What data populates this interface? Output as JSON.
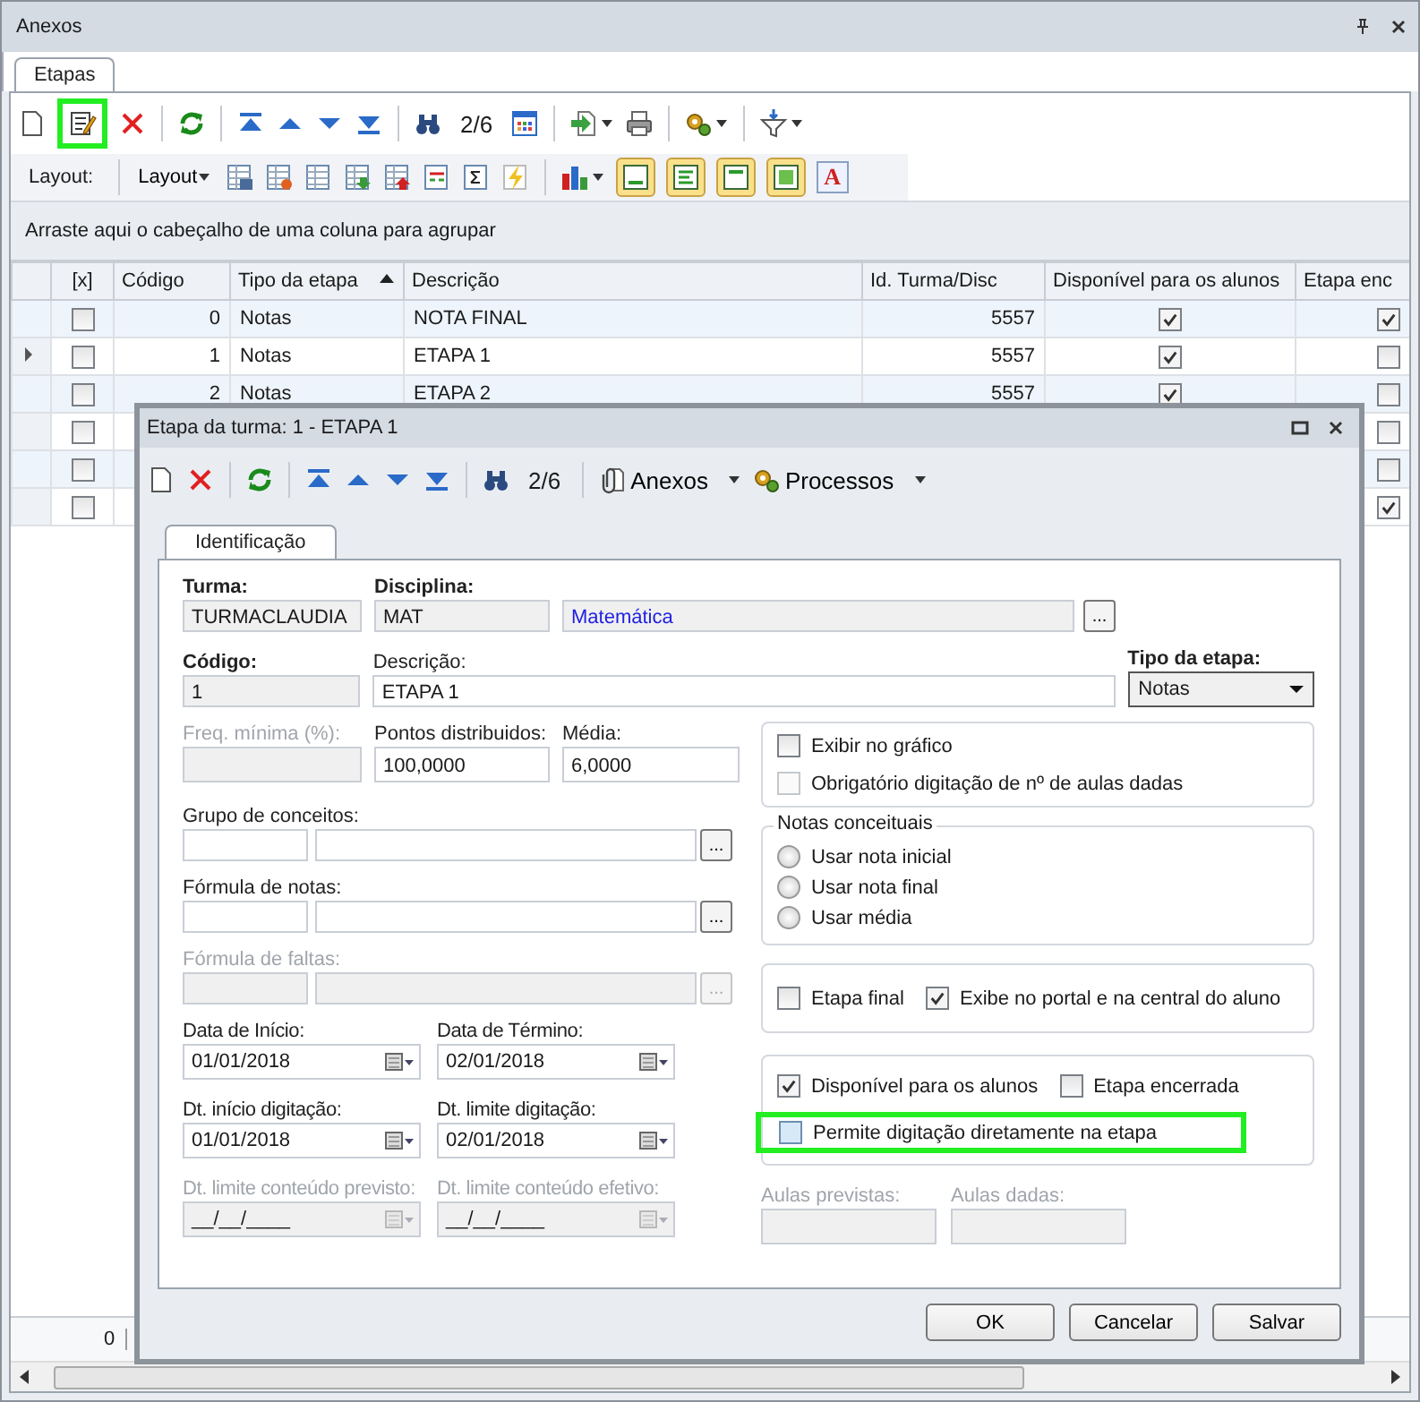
{
  "window": {
    "title": "Anexos"
  },
  "tabs": [
    {
      "label": "Etapas",
      "selected": true
    }
  ],
  "toolbar": {
    "position": "2/6",
    "edit_highlighted": true
  },
  "layout_bar": {
    "label": "Layout:",
    "dropdown": "Layout",
    "toggles": [
      {
        "on": true
      },
      {
        "on": true
      },
      {
        "on": true
      },
      {
        "on": true
      }
    ],
    "font_button": "A"
  },
  "group_panel": "Arraste aqui o cabeçalho de uma coluna para agrupar",
  "grid": {
    "columns": [
      {
        "label": "[x]"
      },
      {
        "label": "Código"
      },
      {
        "label": "Tipo da etapa",
        "sort_ascending": true
      },
      {
        "label": "Descrição"
      },
      {
        "label": "Id. Turma/Disc"
      },
      {
        "label": "Disponível para os alunos"
      },
      {
        "label": "Etapa enc"
      }
    ],
    "rows": [
      {
        "current": false,
        "marked": false,
        "codigo": "0",
        "tipo": "Notas",
        "descricao": "NOTA FINAL",
        "id": "5557",
        "disponivel": true,
        "encerrada": true
      },
      {
        "current": true,
        "marked": false,
        "codigo": "1",
        "tipo": "Notas",
        "descricao": "ETAPA 1",
        "id": "5557",
        "disponivel": true,
        "encerrada": false
      },
      {
        "current": false,
        "marked": false,
        "codigo": "2",
        "tipo": "Notas",
        "descricao": "ETAPA 2",
        "id": "5557",
        "disponivel": true,
        "encerrada": false
      },
      {
        "current": false,
        "marked": false,
        "encerrada": false
      },
      {
        "current": false,
        "marked": false,
        "encerrada": false
      },
      {
        "current": false,
        "marked": false,
        "encerrada": true
      }
    ],
    "footer": "0"
  },
  "dialog": {
    "title": "Etapa da turma: 1 - ETAPA 1",
    "position": "2/6",
    "menus": [
      "Anexos",
      "Processos"
    ],
    "tabs": [
      {
        "label": "Identificação",
        "selected": true
      }
    ],
    "turma": {
      "label": "Turma:",
      "value": "TURMACLAUDIA"
    },
    "disciplina": {
      "label": "Disciplina:",
      "code": "MAT",
      "name": "Matemática",
      "browse": "..."
    },
    "codigo": {
      "label": "Código:",
      "value": "1"
    },
    "descricao": {
      "label": "Descrição:",
      "value": "ETAPA 1"
    },
    "tipo": {
      "label": "Tipo da etapa:",
      "value": "Notas"
    },
    "freq": {
      "label": "Freq. mínima (%):",
      "disabled": true
    },
    "pontos": {
      "label": "Pontos distribuidos:",
      "value": "100,0000"
    },
    "media": {
      "label": "Média:",
      "value": "6,0000"
    },
    "lookups": [
      {
        "label": "Grupo de conceitos:",
        "browse": "...",
        "disabled": false
      },
      {
        "label": "Fórmula de notas:",
        "browse": "...",
        "disabled": false
      },
      {
        "label": "Fórmula de faltas:",
        "browse": "...",
        "disabled": true
      }
    ],
    "dates": [
      {
        "label": "Data de Início:",
        "value": "01/01/2018",
        "disabled": false
      },
      {
        "label": "Data de Término:",
        "value": "02/01/2018",
        "disabled": false
      },
      {
        "label": "Dt. início digitação:",
        "value": "01/01/2018",
        "disabled": false
      },
      {
        "label": "Dt. limite digitação:",
        "value": "02/01/2018",
        "disabled": false
      },
      {
        "label": "Dt. limite conteúdo previsto:",
        "value": "__/__/____",
        "disabled": true
      },
      {
        "label": "Dt. limite conteúdo efetivo:",
        "value": "__/__/____",
        "disabled": true
      }
    ],
    "grafico": [
      {
        "label": "Exibir no gráfico",
        "checked": false,
        "disabled": false
      },
      {
        "label": "Obrigatório digitação de nº de aulas dadas",
        "checked": false,
        "disabled": true
      }
    ],
    "notas_conceituais": {
      "title": "Notas conceituais",
      "options": [
        {
          "label": "Usar nota inicial",
          "selected": false
        },
        {
          "label": "Usar nota final",
          "selected": false
        },
        {
          "label": "Usar média",
          "selected": false
        }
      ]
    },
    "flags": [
      {
        "label": "Etapa final",
        "checked": false
      },
      {
        "label": "Exibe no portal e na central do aluno",
        "checked": true
      }
    ],
    "publish": [
      {
        "label": "Disponível para os alunos",
        "checked": true,
        "highlighted": false
      },
      {
        "label": "Etapa encerrada",
        "checked": false,
        "highlighted": false
      },
      {
        "label": "Permite digitação diretamente na etapa",
        "checked": false,
        "highlighted": true
      }
    ],
    "aulas": [
      {
        "label": "Aulas previstas:"
      },
      {
        "label": "Aulas dadas:"
      }
    ],
    "buttons": [
      "OK",
      "Cancelar",
      "Salvar"
    ]
  }
}
